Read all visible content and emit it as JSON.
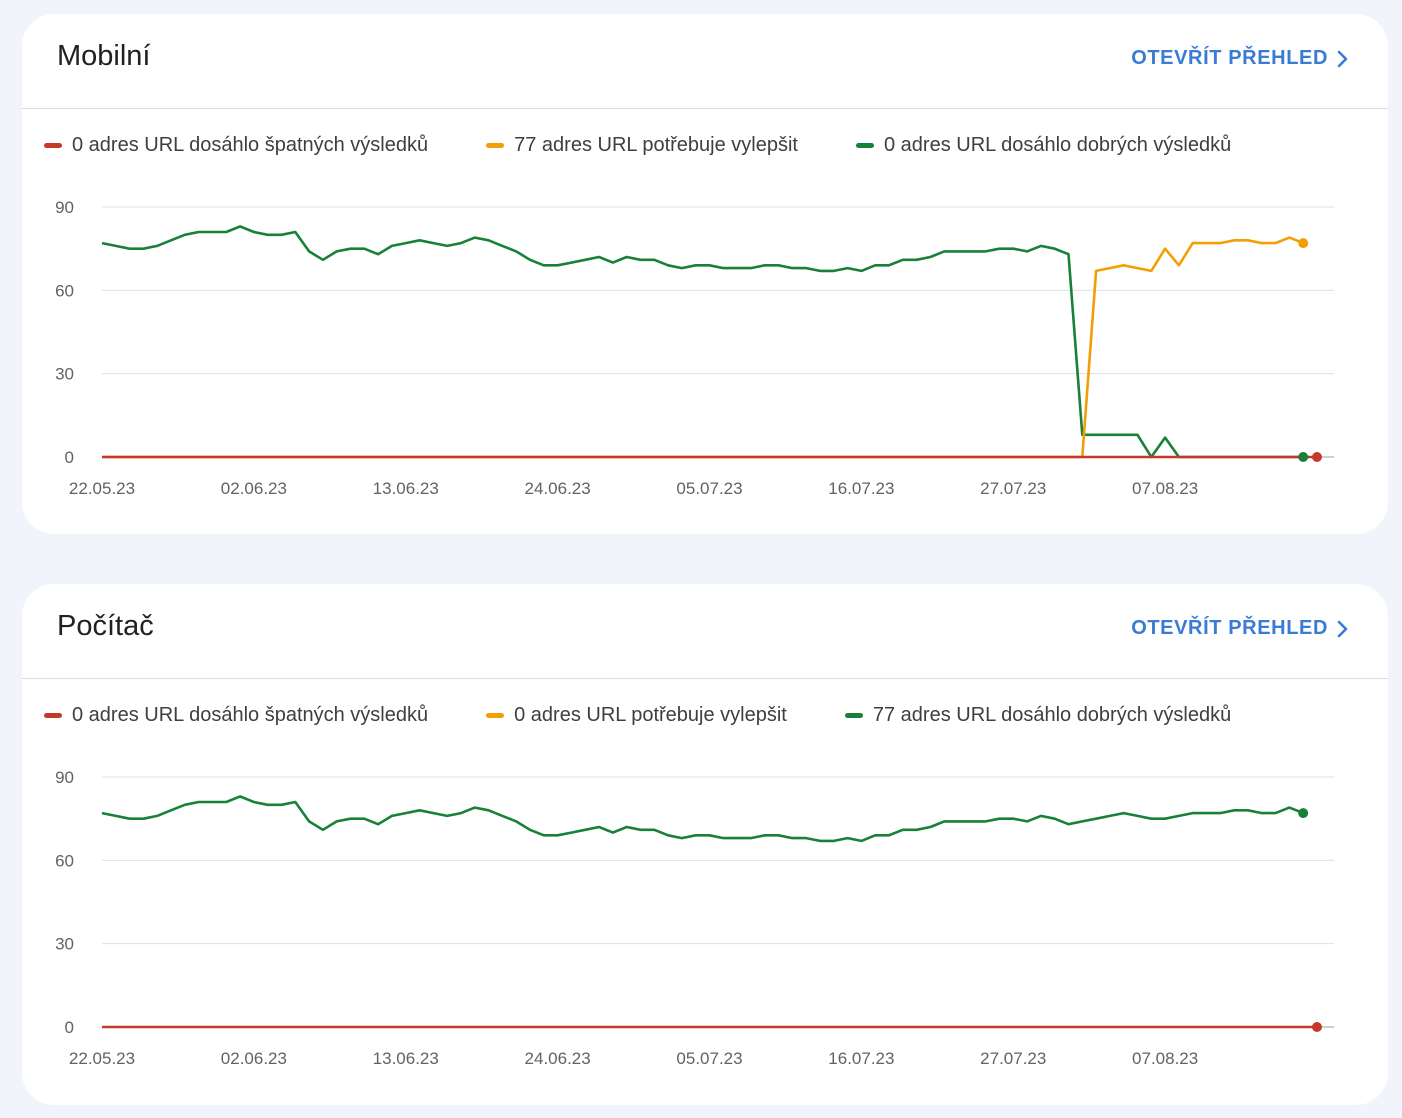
{
  "cards": [
    {
      "title": "Mobilní",
      "link_label": "OTEVŘÍT PŘEHLED",
      "legend": [
        {
          "label": "0 adres URL dosáhlo špatných výsledků",
          "color": "#c5392b"
        },
        {
          "label": "77 adres URL potřebuje vylepšit",
          "color": "#f29f05"
        },
        {
          "label": "0 adres URL dosáhlo dobrých výsledků",
          "color": "#188038"
        }
      ]
    },
    {
      "title": "Počítač",
      "link_label": "OTEVŘÍT PŘEHLED",
      "legend": [
        {
          "label": "0 adres URL dosáhlo špatných výsledků",
          "color": "#c5392b"
        },
        {
          "label": "0 adres URL potřebuje vylepšit",
          "color": "#f29f05"
        },
        {
          "label": "77 adres URL dosáhlo dobrých výsledků",
          "color": "#188038"
        }
      ]
    }
  ],
  "chart_data": [
    {
      "type": "line",
      "x_start": "2023-05-22",
      "x_tick_labels": [
        "22.05.23",
        "02.06.23",
        "13.06.23",
        "24.06.23",
        "05.07.23",
        "16.07.23",
        "27.07.23",
        "07.08.23"
      ],
      "y_ticks": [
        0,
        30,
        60,
        90
      ],
      "ylim": [
        0,
        90
      ],
      "grid": true,
      "series": [
        {
          "name": "0 adres URL dosáhlo špatných výsledků",
          "color": "#c5392b",
          "values": [
            0,
            0,
            0,
            0,
            0,
            0,
            0,
            0,
            0,
            0,
            0,
            0,
            0,
            0,
            0,
            0,
            0,
            0,
            0,
            0,
            0,
            0,
            0,
            0,
            0,
            0,
            0,
            0,
            0,
            0,
            0,
            0,
            0,
            0,
            0,
            0,
            0,
            0,
            0,
            0,
            0,
            0,
            0,
            0,
            0,
            0,
            0,
            0,
            0,
            0,
            0,
            0,
            0,
            0,
            0,
            0,
            0,
            0,
            0,
            0,
            0,
            0,
            0,
            0,
            0,
            0,
            0,
            0,
            0,
            0,
            0,
            0,
            0,
            0,
            0,
            0,
            0,
            0,
            0,
            0,
            0,
            0,
            0,
            0,
            0,
            0,
            0,
            0,
            0
          ]
        },
        {
          "name": "77 adres URL potřebuje vylepšit",
          "color": "#f29f05",
          "values": [
            0,
            0,
            0,
            0,
            0,
            0,
            0,
            0,
            0,
            0,
            0,
            0,
            0,
            0,
            0,
            0,
            0,
            0,
            0,
            0,
            0,
            0,
            0,
            0,
            0,
            0,
            0,
            0,
            0,
            0,
            0,
            0,
            0,
            0,
            0,
            0,
            0,
            0,
            0,
            0,
            0,
            0,
            0,
            0,
            0,
            0,
            0,
            0,
            0,
            0,
            0,
            0,
            0,
            0,
            0,
            0,
            0,
            0,
            0,
            0,
            0,
            0,
            0,
            0,
            0,
            0,
            0,
            0,
            0,
            0,
            0,
            0,
            67,
            68,
            69,
            68,
            67,
            75,
            69,
            77,
            77,
            77,
            78,
            78,
            77,
            77,
            79,
            77
          ]
        },
        {
          "name": "0 adres URL dosáhlo dobrých výsledků",
          "color": "#188038",
          "values": [
            77,
            76,
            75,
            75,
            76,
            78,
            80,
            81,
            81,
            81,
            83,
            81,
            80,
            80,
            81,
            74,
            71,
            74,
            75,
            75,
            73,
            76,
            77,
            78,
            77,
            76,
            77,
            79,
            78,
            76,
            74,
            71,
            69,
            69,
            70,
            71,
            72,
            70,
            72,
            71,
            71,
            69,
            68,
            69,
            69,
            68,
            68,
            68,
            69,
            69,
            68,
            68,
            67,
            67,
            68,
            67,
            69,
            69,
            71,
            71,
            72,
            74,
            74,
            74,
            74,
            75,
            75,
            74,
            76,
            75,
            73,
            8,
            8,
            8,
            8,
            8,
            0,
            7,
            0,
            0,
            0,
            0,
            0,
            0,
            0,
            0,
            0,
            0
          ]
        }
      ]
    },
    {
      "type": "line",
      "x_start": "2023-05-22",
      "x_tick_labels": [
        "22.05.23",
        "02.06.23",
        "13.06.23",
        "24.06.23",
        "05.07.23",
        "16.07.23",
        "27.07.23",
        "07.08.23"
      ],
      "y_ticks": [
        0,
        30,
        60,
        90
      ],
      "ylim": [
        0,
        90
      ],
      "grid": true,
      "series": [
        {
          "name": "0 adres URL dosáhlo špatných výsledků",
          "color": "#c5392b",
          "values": [
            0,
            0,
            0,
            0,
            0,
            0,
            0,
            0,
            0,
            0,
            0,
            0,
            0,
            0,
            0,
            0,
            0,
            0,
            0,
            0,
            0,
            0,
            0,
            0,
            0,
            0,
            0,
            0,
            0,
            0,
            0,
            0,
            0,
            0,
            0,
            0,
            0,
            0,
            0,
            0,
            0,
            0,
            0,
            0,
            0,
            0,
            0,
            0,
            0,
            0,
            0,
            0,
            0,
            0,
            0,
            0,
            0,
            0,
            0,
            0,
            0,
            0,
            0,
            0,
            0,
            0,
            0,
            0,
            0,
            0,
            0,
            0,
            0,
            0,
            0,
            0,
            0,
            0,
            0,
            0,
            0,
            0,
            0,
            0,
            0,
            0,
            0,
            0,
            0
          ]
        },
        {
          "name": "77 adres URL dosáhlo dobrých výsledků",
          "color": "#188038",
          "values": [
            77,
            76,
            75,
            75,
            76,
            78,
            80,
            81,
            81,
            81,
            83,
            81,
            80,
            80,
            81,
            74,
            71,
            74,
            75,
            75,
            73,
            76,
            77,
            78,
            77,
            76,
            77,
            79,
            78,
            76,
            74,
            71,
            69,
            69,
            70,
            71,
            72,
            70,
            72,
            71,
            71,
            69,
            68,
            69,
            69,
            68,
            68,
            68,
            69,
            69,
            68,
            68,
            67,
            67,
            68,
            67,
            69,
            69,
            71,
            71,
            72,
            74,
            74,
            74,
            74,
            75,
            75,
            74,
            76,
            75,
            73,
            74,
            75,
            76,
            77,
            76,
            75,
            75,
            76,
            77,
            77,
            77,
            78,
            78,
            77,
            77,
            79,
            77
          ]
        }
      ]
    }
  ]
}
